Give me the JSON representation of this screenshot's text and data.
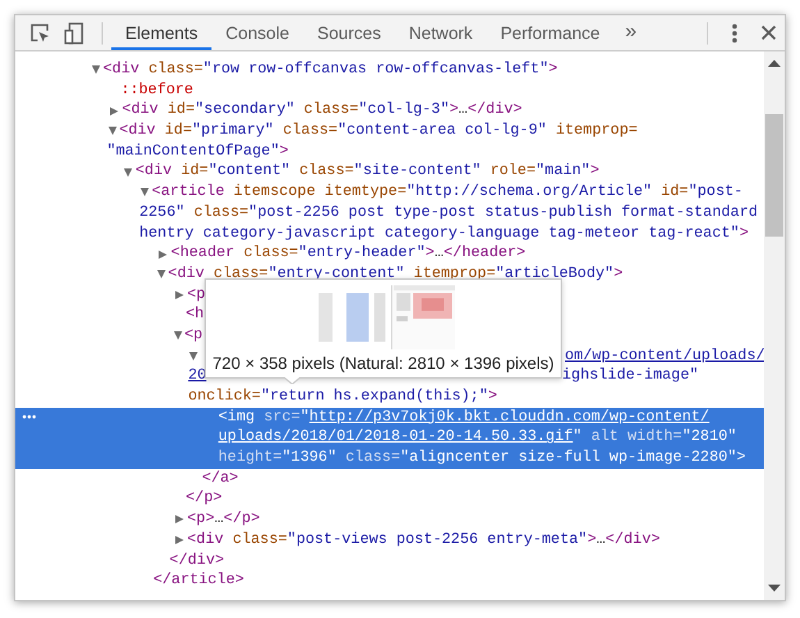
{
  "toolbar": {
    "tabs": [
      {
        "label": "Elements",
        "selected": true
      },
      {
        "label": "Console",
        "selected": false
      },
      {
        "label": "Sources",
        "selected": false
      },
      {
        "label": "Network",
        "selected": false
      },
      {
        "label": "Performance",
        "selected": false
      }
    ],
    "overflow": "»"
  },
  "tree": [
    {
      "selected": false,
      "expanded": true,
      "lines": [
        [
          {
            "kind": "tag",
            "text": "<div"
          },
          {
            "kind": "attr",
            "text": " class="
          },
          {
            "kind": "value",
            "text": "\"row row-offcanvas row-offcanvas-left\""
          },
          {
            "kind": "tag",
            "text": ">"
          }
        ]
      ],
      "children": [
        {
          "selected": false,
          "lines": [
            [
              {
                "kind": "pseudo",
                "text": "::before"
              }
            ]
          ]
        },
        {
          "selected": false,
          "expanded": false,
          "lines": [
            [
              {
                "kind": "tag",
                "text": "<div"
              },
              {
                "kind": "attr",
                "text": " id="
              },
              {
                "kind": "value",
                "text": "\"secondary\""
              },
              {
                "kind": "attr",
                "text": " class="
              },
              {
                "kind": "value",
                "text": "\"col-lg-3\""
              },
              {
                "kind": "tag",
                "text": ">"
              },
              {
                "kind": "plain",
                "text": "…"
              },
              {
                "kind": "tag",
                "text": "</div>"
              }
            ]
          ]
        },
        {
          "selected": false,
          "expanded": true,
          "lines": [
            [
              {
                "kind": "tag",
                "text": "<div"
              },
              {
                "kind": "attr",
                "text": " id="
              },
              {
                "kind": "value",
                "text": "\"primary\""
              },
              {
                "kind": "attr",
                "text": " class="
              },
              {
                "kind": "value",
                "text": "\"content-area col-lg-9\""
              },
              {
                "kind": "attr",
                "text": " itemprop="
              }
            ],
            [
              {
                "kind": "value",
                "text": "\"mainContentOfPage\""
              },
              {
                "kind": "tag",
                "text": ">"
              }
            ]
          ],
          "children": [
            {
              "selected": false,
              "expanded": true,
              "lines": [
                [
                  {
                    "kind": "tag",
                    "text": "<div"
                  },
                  {
                    "kind": "attr",
                    "text": " id="
                  },
                  {
                    "kind": "value",
                    "text": "\"content\""
                  },
                  {
                    "kind": "attr",
                    "text": " class="
                  },
                  {
                    "kind": "value",
                    "text": "\"site-content\""
                  },
                  {
                    "kind": "attr",
                    "text": " role="
                  },
                  {
                    "kind": "value",
                    "text": "\"main\""
                  },
                  {
                    "kind": "tag",
                    "text": ">"
                  }
                ]
              ],
              "children": [
                {
                  "selected": false,
                  "expanded": true,
                  "lines": [
                    [
                      {
                        "kind": "tag",
                        "text": "<article"
                      },
                      {
                        "kind": "attr",
                        "text": " itemscope itemtype="
                      },
                      {
                        "kind": "value",
                        "text": "\"http://schema.org/Article\""
                      },
                      {
                        "kind": "attr",
                        "text": " id="
                      },
                      {
                        "kind": "value",
                        "text": "\"post-"
                      }
                    ],
                    [
                      {
                        "kind": "value",
                        "text": "2256\""
                      },
                      {
                        "kind": "attr",
                        "text": " class="
                      },
                      {
                        "kind": "value",
                        "text": "\"post-2256 post type-post status-publish format-standard"
                      }
                    ],
                    [
                      {
                        "kind": "value",
                        "text": "hentry category-javascript category-language tag-meteor tag-react\""
                      },
                      {
                        "kind": "tag",
                        "text": ">"
                      }
                    ]
                  ],
                  "children": [
                    {
                      "selected": false,
                      "expanded": false,
                      "lines": [
                        [
                          {
                            "kind": "tag",
                            "text": "<header"
                          },
                          {
                            "kind": "attr",
                            "text": " class="
                          },
                          {
                            "kind": "value",
                            "text": "\"entry-header\""
                          },
                          {
                            "kind": "tag",
                            "text": ">"
                          },
                          {
                            "kind": "plain",
                            "text": "…"
                          },
                          {
                            "kind": "tag",
                            "text": "</header>"
                          }
                        ]
                      ]
                    },
                    {
                      "selected": false,
                      "expanded": true,
                      "lines": [
                        [
                          {
                            "kind": "tag",
                            "text": "<div"
                          },
                          {
                            "kind": "attr",
                            "text": " class="
                          },
                          {
                            "kind": "value",
                            "text": "\"entry-content\""
                          },
                          {
                            "kind": "attr",
                            "text": " itemprop="
                          },
                          {
                            "kind": "value",
                            "text": "\"articleBody\""
                          },
                          {
                            "kind": "tag",
                            "text": ">"
                          }
                        ]
                      ],
                      "children": [
                        {
                          "selected": false,
                          "expanded": false,
                          "lines": [
                            [
                              {
                                "kind": "tag",
                                "text": "<p"
                              }
                            ]
                          ]
                        },
                        {
                          "selected": false,
                          "lines": [
                            [
                              {
                                "kind": "tag",
                                "text": "<h"
                              }
                            ]
                          ]
                        },
                        {
                          "selected": false,
                          "expanded": true,
                          "lines": [
                            [
                              {
                                "kind": "tag",
                                "text": "<p"
                              }
                            ]
                          ],
                          "children": [
                            {
                              "selected": false,
                              "expanded": true,
                              "lines": [
                                [
                                  {
                                    "kind": "link",
                                    "text": "om/wp-content/uploads/",
                                    "after_tooltip": true
                                  }
                                ],
                                [
                                  {
                                    "kind": "link",
                                    "text": "20"
                                  },
                                  {
                                    "kind": "value",
                                    "text": "ighslide-image\"",
                                    "after_tooltip": true
                                  }
                                ],
                                [
                                  {
                                    "kind": "attr",
                                    "text": "onclick="
                                  },
                                  {
                                    "kind": "value",
                                    "text": "\"return hs.expand(this);\""
                                  },
                                  {
                                    "kind": "tag",
                                    "text": ">"
                                  }
                                ]
                              ],
                              "children": [
                                {
                                  "selected": true,
                                  "lines": [
                                    [
                                      {
                                        "kind": "tag",
                                        "text": "<img"
                                      },
                                      {
                                        "kind": "attr",
                                        "text": " src="
                                      },
                                      {
                                        "kind": "value",
                                        "text": "\""
                                      },
                                      {
                                        "kind": "link",
                                        "text": "http://p3v7okj0k.bkt.clouddn.com/wp-content/"
                                      }
                                    ],
                                    [
                                      {
                                        "kind": "link",
                                        "text": "uploads/2018/01/2018-01-20-14.50.33.gif"
                                      },
                                      {
                                        "kind": "value",
                                        "text": "\""
                                      },
                                      {
                                        "kind": "attr",
                                        "text": " alt width="
                                      },
                                      {
                                        "kind": "value",
                                        "text": "\"2810\""
                                      }
                                    ],
                                    [
                                      {
                                        "kind": "attr",
                                        "text": "height="
                                      },
                                      {
                                        "kind": "value",
                                        "text": "\"1396\""
                                      },
                                      {
                                        "kind": "attr",
                                        "text": " class="
                                      },
                                      {
                                        "kind": "value",
                                        "text": "\"aligncenter size-full wp-image-2280\""
                                      },
                                      {
                                        "kind": "tag",
                                        "text": ">"
                                      }
                                    ]
                                  ]
                                }
                              ]
                            },
                            {
                              "selected": false,
                              "lines": [
                                [
                                  {
                                    "kind": "tag",
                                    "text": "</a>"
                                  }
                                ]
                              ]
                            }
                          ]
                        },
                        {
                          "selected": false,
                          "lines": [
                            [
                              {
                                "kind": "tag",
                                "text": "</p>"
                              }
                            ]
                          ]
                        },
                        {
                          "selected": false,
                          "expanded": false,
                          "lines": [
                            [
                              {
                                "kind": "tag",
                                "text": "<p>"
                              },
                              {
                                "kind": "plain",
                                "text": "…"
                              },
                              {
                                "kind": "tag",
                                "text": "</p>"
                              }
                            ]
                          ]
                        },
                        {
                          "selected": false,
                          "expanded": false,
                          "lines": [
                            [
                              {
                                "kind": "tag",
                                "text": "<div"
                              },
                              {
                                "kind": "attr",
                                "text": " class="
                              },
                              {
                                "kind": "value",
                                "text": "\"post-views post-2256 entry-meta\""
                              },
                              {
                                "kind": "tag",
                                "text": ">"
                              },
                              {
                                "kind": "plain",
                                "text": "…"
                              },
                              {
                                "kind": "tag",
                                "text": "</div>"
                              }
                            ]
                          ]
                        }
                      ]
                    },
                    {
                      "selected": false,
                      "lines": [
                        [
                          {
                            "kind": "tag",
                            "text": "</div>"
                          }
                        ]
                      ]
                    }
                  ]
                },
                {
                  "selected": false,
                  "lines": [
                    [
                      {
                        "kind": "tag",
                        "text": "</article>"
                      }
                    ]
                  ]
                }
              ]
            }
          ]
        }
      ]
    }
  ],
  "tooltip": {
    "text": "720 × 358 pixels (Natural: 2810 × 1396 pixels)"
  }
}
